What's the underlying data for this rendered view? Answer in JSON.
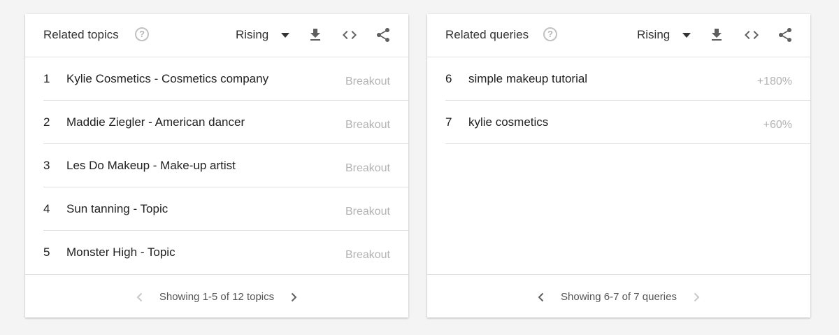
{
  "colors": {
    "background": "#f4f4f4",
    "card": "#ffffff",
    "divider": "#e0e0e0",
    "text": "#212121",
    "muted_value": "#b3b3b3",
    "icon_active": "#5f5f5f",
    "icon_disabled": "#c8c8c8"
  },
  "topics": {
    "title": "Related topics",
    "help_icon": "?",
    "filter": "Rising",
    "rows": [
      {
        "index": "1",
        "label": "Kylie Cosmetics - Cosmetics company",
        "value": "Breakout"
      },
      {
        "index": "2",
        "label": "Maddie Ziegler - American dancer",
        "value": "Breakout"
      },
      {
        "index": "3",
        "label": "Les Do Makeup - Make-up artist",
        "value": "Breakout"
      },
      {
        "index": "4",
        "label": "Sun tanning - Topic",
        "value": "Breakout"
      },
      {
        "index": "5",
        "label": "Monster High - Topic",
        "value": "Breakout"
      }
    ],
    "pager_text": "Showing 1-5 of 12 topics",
    "prev_enabled": false,
    "next_enabled": true
  },
  "queries": {
    "title": "Related queries",
    "help_icon": "?",
    "filter": "Rising",
    "rows": [
      {
        "index": "6",
        "label": "simple makeup tutorial",
        "value": "+180%"
      },
      {
        "index": "7",
        "label": "kylie cosmetics",
        "value": "+60%"
      }
    ],
    "pager_text": "Showing 6-7 of 7 queries",
    "prev_enabled": true,
    "next_enabled": false
  }
}
